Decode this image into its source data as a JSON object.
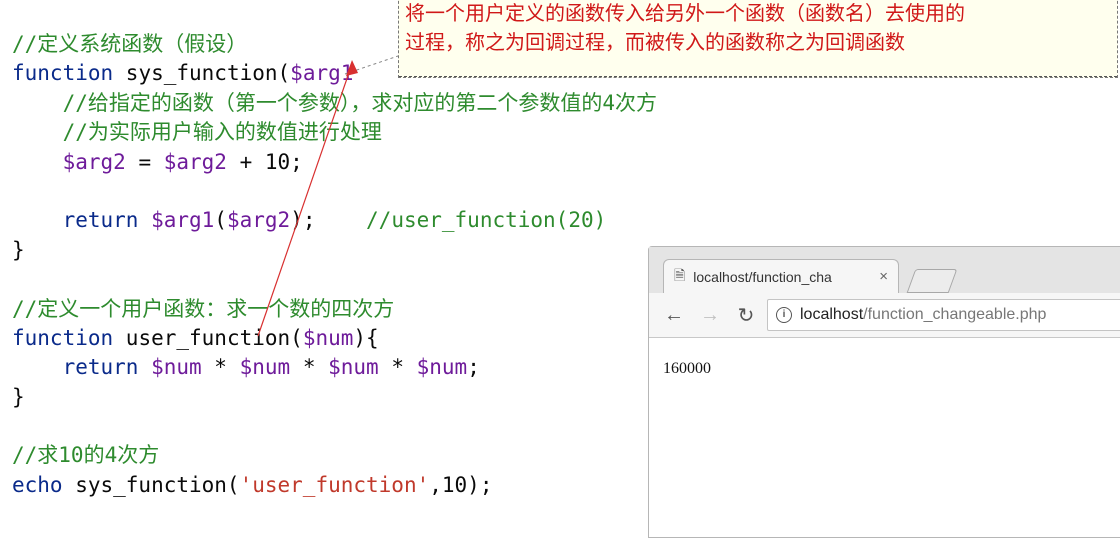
{
  "code_lines": [
    [
      {
        "t": "//定义系统函数（假设）",
        "c": "cm"
      }
    ],
    [
      {
        "t": "function ",
        "c": "kw"
      },
      {
        "t": "sys_function(",
        "c": "plain"
      },
      {
        "t": "$arg1",
        "c": "var"
      }
    ],
    [
      {
        "t": "    //给指定的函数（第一个参数），求对应的第二个参数值的4次方",
        "c": "cm"
      }
    ],
    [
      {
        "t": "    //为实际用户输入的数值进行处理",
        "c": "cm"
      }
    ],
    [
      {
        "t": "    ",
        "c": "plain"
      },
      {
        "t": "$arg2",
        "c": "var"
      },
      {
        "t": " = ",
        "c": "plain"
      },
      {
        "t": "$arg2",
        "c": "var"
      },
      {
        "t": " + 10;",
        "c": "plain"
      }
    ],
    [
      {
        "t": "",
        "c": "plain"
      }
    ],
    [
      {
        "t": "    return ",
        "c": "kw"
      },
      {
        "t": "$arg1",
        "c": "var"
      },
      {
        "t": "(",
        "c": "plain"
      },
      {
        "t": "$arg2",
        "c": "var"
      },
      {
        "t": ");    ",
        "c": "plain"
      },
      {
        "t": "//user_function(20)",
        "c": "cm"
      }
    ],
    [
      {
        "t": "}",
        "c": "plain"
      }
    ],
    [
      {
        "t": "",
        "c": "plain"
      }
    ],
    [
      {
        "t": "//定义一个用户函数：求一个数的四次方",
        "c": "cm"
      }
    ],
    [
      {
        "t": "function ",
        "c": "kw"
      },
      {
        "t": "user_function(",
        "c": "plain"
      },
      {
        "t": "$num",
        "c": "var"
      },
      {
        "t": "){",
        "c": "plain"
      }
    ],
    [
      {
        "t": "    return ",
        "c": "kw"
      },
      {
        "t": "$num",
        "c": "var"
      },
      {
        "t": " * ",
        "c": "plain"
      },
      {
        "t": "$num",
        "c": "var"
      },
      {
        "t": " * ",
        "c": "plain"
      },
      {
        "t": "$num",
        "c": "var"
      },
      {
        "t": " * ",
        "c": "plain"
      },
      {
        "t": "$num",
        "c": "var"
      },
      {
        "t": ";",
        "c": "plain"
      }
    ],
    [
      {
        "t": "}",
        "c": "plain"
      }
    ],
    [
      {
        "t": "",
        "c": "plain"
      }
    ],
    [
      {
        "t": "//求10的4次方",
        "c": "cm"
      }
    ],
    [
      {
        "t": "echo ",
        "c": "kw"
      },
      {
        "t": "sys_function(",
        "c": "plain"
      },
      {
        "t": "'user_function'",
        "c": "str"
      },
      {
        "t": ",10);",
        "c": "plain"
      }
    ]
  ],
  "annotation": {
    "line1": "将一个用户定义的函数传入给另外一个函数（函数名）去使用的",
    "line2": "过程，称之为回调过程，而被传入的函数称之为回调函数"
  },
  "browser": {
    "tab_title": "localhost/function_cha",
    "tab_close": "×",
    "url_host": "localhost",
    "url_path": "/function_changeable.php",
    "output": "160000"
  },
  "colors": {
    "comment": "#2e8b2e",
    "keyword": "#0a2a8a",
    "variable": "#6e1b9a",
    "string": "#c0392b",
    "annotation_text": "#d01818"
  }
}
